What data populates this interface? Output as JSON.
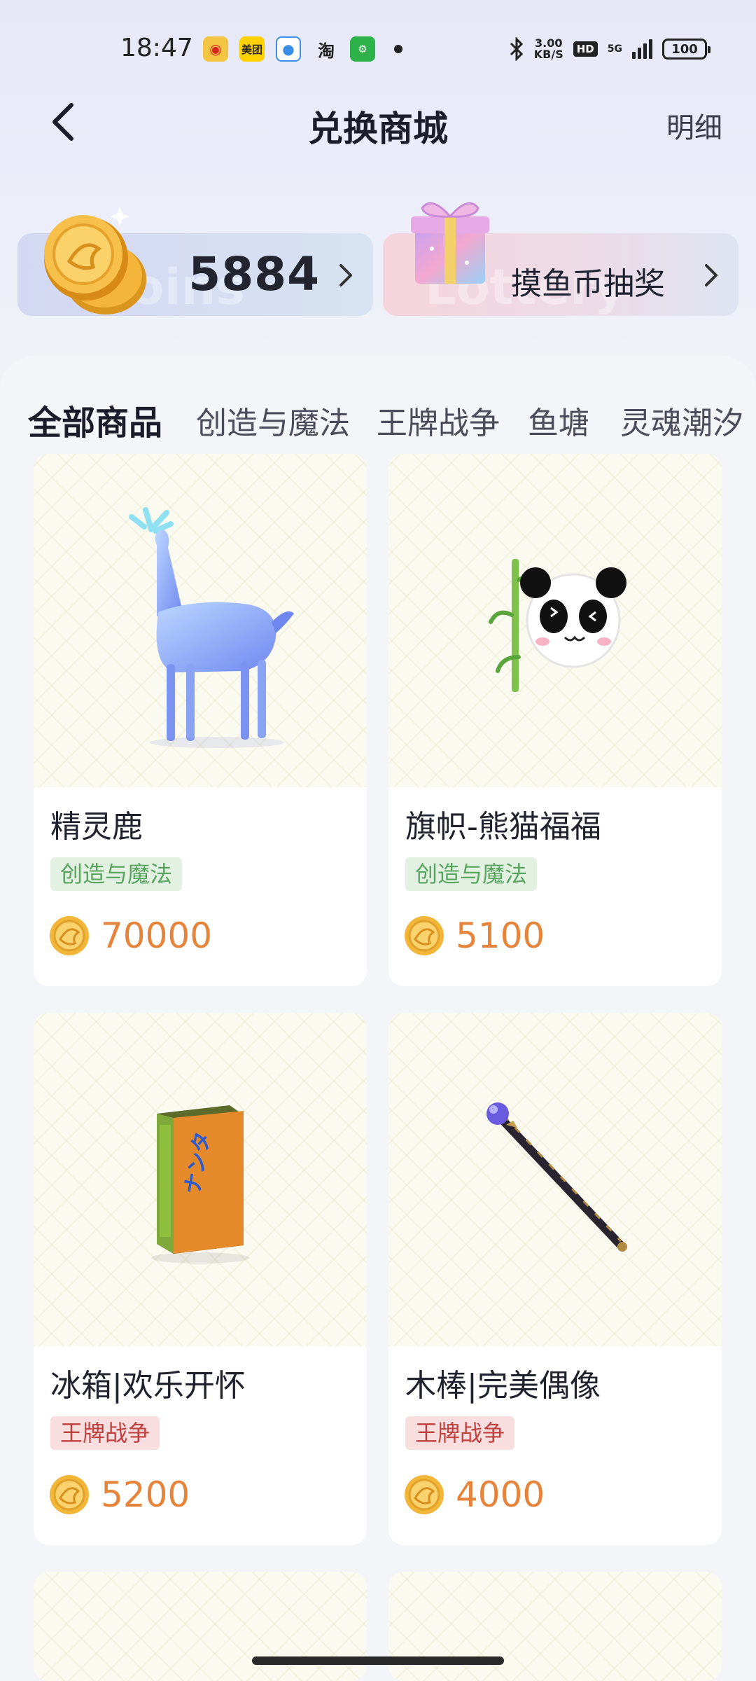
{
  "status_bar": {
    "time": "18:47",
    "speed_value": "3.00",
    "speed_unit": "KB/S",
    "hd": "HD",
    "network": "5G",
    "battery": "100",
    "apps": [
      "weibo",
      "meituan",
      "qq",
      "taobao",
      "app"
    ]
  },
  "header": {
    "title": "兑换商城",
    "detail_link": "明细"
  },
  "coins_card": {
    "value": "5884",
    "watermark": "Coins"
  },
  "lottery_card": {
    "label": "摸鱼币抽奖",
    "watermark": "Lottery"
  },
  "tabs": [
    {
      "label": "全部商品",
      "active": true
    },
    {
      "label": "创造与魔法",
      "active": false
    },
    {
      "label": "王牌战争",
      "active": false
    },
    {
      "label": "鱼塘",
      "active": false
    },
    {
      "label": "灵魂潮汐",
      "active": false
    }
  ],
  "products": [
    {
      "name": "精灵鹿",
      "tag": "创造与魔法",
      "price": "70000",
      "icon": "spirit-deer"
    },
    {
      "name": "旗帜-熊猫福福",
      "tag": "创造与魔法",
      "price": "5100",
      "icon": "panda-flag"
    },
    {
      "name": "冰箱|欢乐开怀",
      "tag": "王牌战争",
      "price": "5200",
      "icon": "fridge"
    },
    {
      "name": "木棒|完美偶像",
      "tag": "王牌战争",
      "price": "4000",
      "icon": "staff"
    }
  ],
  "colors": {
    "accent": "#8a72ee",
    "price": "#e5843a",
    "tag_green_bg": "#e3f1e3",
    "tag_green_text": "#57a45e",
    "tag_red_bg": "#f8dede",
    "tag_red_text": "#c0403e"
  }
}
